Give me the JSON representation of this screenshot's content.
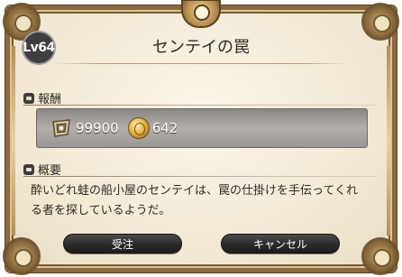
{
  "dialog": {
    "level": "Lv64",
    "title": "センテイの罠"
  },
  "reward": {
    "heading": "報酬",
    "exp": "99900",
    "gil": "642"
  },
  "summary": {
    "heading": "概要",
    "line1": "酔いどれ蛙の船小屋のセンテイは、罠の仕掛けを手伝ってくれ",
    "line2": "る者を探しているようだ。"
  },
  "buttons": {
    "accept": "受注",
    "cancel": "キャンセル"
  },
  "icons": {
    "exp": "exp-icon",
    "gil": "gil-coin-icon",
    "reward_bullet": "section-bullet-icon",
    "summary_bullet": "section-bullet-icon"
  }
}
